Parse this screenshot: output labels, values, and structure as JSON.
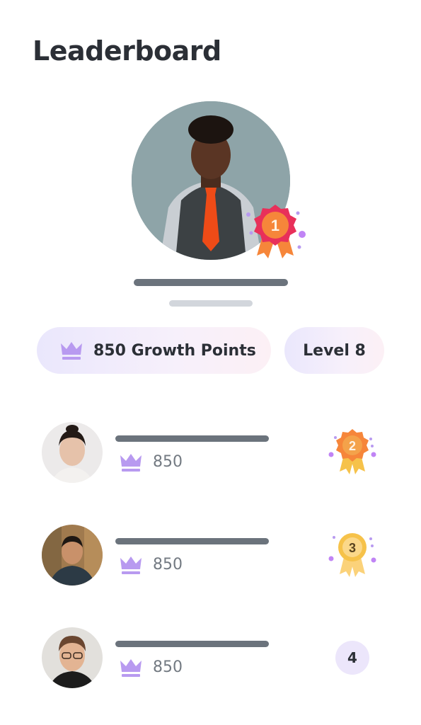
{
  "page": {
    "title": "Leaderboard"
  },
  "leader": {
    "rank": "1",
    "avatar": "leader-avatar",
    "badge_icon": "ribbon-medal-icon"
  },
  "stats": {
    "points_label": "850 Growth Points",
    "points_icon": "crown-icon",
    "level_label": "Level 8"
  },
  "colors": {
    "accent": "#b89af0",
    "pill_start": "#eae7fc",
    "pill_end": "#fcf0f5",
    "medal_red": "#e8305a",
    "medal_orange": "#f6863a",
    "medal_gold": "#f6c24a",
    "text_dark": "#2b2f36",
    "text_muted": "#737a82"
  },
  "entries": [
    {
      "rank": "2",
      "score": "850",
      "icon": "crown-icon",
      "medal": "orange-ribbon-medal-icon"
    },
    {
      "rank": "3",
      "score": "850",
      "icon": "crown-icon",
      "medal": "gold-ribbon-medal-icon"
    },
    {
      "rank": "4",
      "score": "850",
      "icon": "crown-icon",
      "medal": "rank-circle"
    }
  ]
}
